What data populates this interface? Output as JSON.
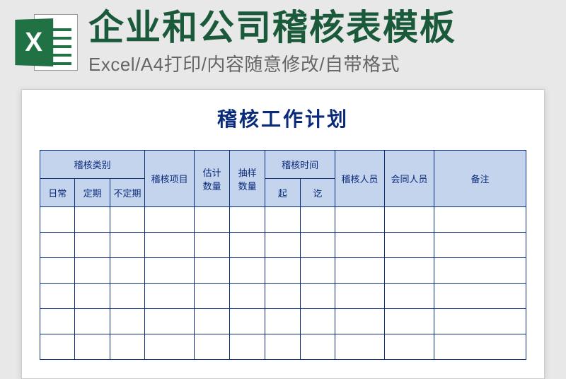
{
  "header": {
    "icon_letter": "X",
    "main_title": "企业和公司稽核表模板",
    "sub_title": "Excel/A4打印/内容随意修改/自带格式"
  },
  "document": {
    "title": "稽核工作计划",
    "columns": {
      "category_group": "稽核类别",
      "category_daily": "日常",
      "category_periodic": "定期",
      "category_irregular": "不定期",
      "project": "稽核项目",
      "est_qty": "估计\n数量",
      "sample_qty": "抽样\n数量",
      "time_group": "稽核时间",
      "time_from": "起",
      "time_to": "讫",
      "auditor": "稽核人员",
      "co_person": "会同人员",
      "notes": "备注"
    },
    "rows": [
      {
        "daily": "",
        "periodic": "",
        "irregular": "",
        "project": "",
        "est": "",
        "sample": "",
        "from": "",
        "to": "",
        "auditor": "",
        "co": "",
        "notes": ""
      },
      {
        "daily": "",
        "periodic": "",
        "irregular": "",
        "project": "",
        "est": "",
        "sample": "",
        "from": "",
        "to": "",
        "auditor": "",
        "co": "",
        "notes": ""
      },
      {
        "daily": "",
        "periodic": "",
        "irregular": "",
        "project": "",
        "est": "",
        "sample": "",
        "from": "",
        "to": "",
        "auditor": "",
        "co": "",
        "notes": ""
      },
      {
        "daily": "",
        "periodic": "",
        "irregular": "",
        "project": "",
        "est": "",
        "sample": "",
        "from": "",
        "to": "",
        "auditor": "",
        "co": "",
        "notes": ""
      },
      {
        "daily": "",
        "periodic": "",
        "irregular": "",
        "project": "",
        "est": "",
        "sample": "",
        "from": "",
        "to": "",
        "auditor": "",
        "co": "",
        "notes": ""
      },
      {
        "daily": "",
        "periodic": "",
        "irregular": "",
        "project": "",
        "est": "",
        "sample": "",
        "from": "",
        "to": "",
        "auditor": "",
        "co": "",
        "notes": ""
      }
    ]
  }
}
